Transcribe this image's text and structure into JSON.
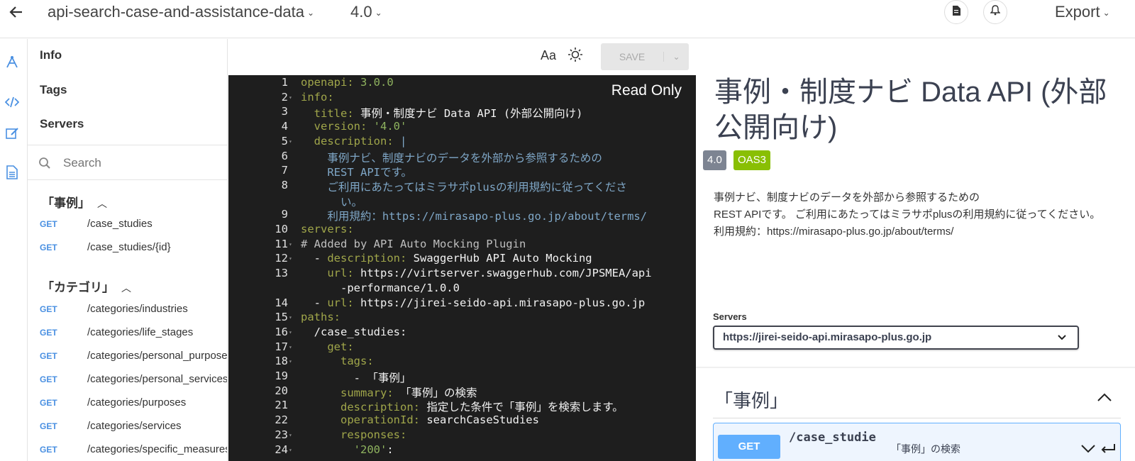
{
  "header": {
    "api_name": "api-search-case-and-assistance-data",
    "version": "4.0",
    "export_label": "Export"
  },
  "nav": {
    "top_items": [
      "Info",
      "Tags",
      "Servers"
    ],
    "search_placeholder": "Search",
    "groups": [
      {
        "title": "「事例」",
        "endpoints": [
          {
            "method": "GET",
            "path": "/case_studies"
          },
          {
            "method": "GET",
            "path": "/case_studies/{id}"
          }
        ]
      },
      {
        "title": "「カテゴリ」",
        "endpoints": [
          {
            "method": "GET",
            "path": "/categories/industries"
          },
          {
            "method": "GET",
            "path": "/categories/life_stages"
          },
          {
            "method": "GET",
            "path": "/categories/personal_purposes"
          },
          {
            "method": "GET",
            "path": "/categories/personal_services"
          },
          {
            "method": "GET",
            "path": "/categories/purposes"
          },
          {
            "method": "GET",
            "path": "/categories/services"
          },
          {
            "method": "GET",
            "path": "/categories/specific_measures"
          }
        ]
      }
    ]
  },
  "editor": {
    "font_label": "Aa",
    "save_label": "SAVE",
    "read_only_label": "Read Only",
    "lines": [
      {
        "n": "1",
        "fold": false,
        "parts": [
          [
            "k",
            "openapi: "
          ],
          [
            "g",
            "3.0.0"
          ]
        ]
      },
      {
        "n": "2",
        "fold": true,
        "parts": [
          [
            "k",
            "info:"
          ]
        ]
      },
      {
        "n": "3",
        "fold": false,
        "parts": [
          [
            "v",
            "  "
          ],
          [
            "k",
            "title: "
          ],
          [
            "v",
            "事例・制度ナビ Data API (外部公開向け)"
          ]
        ]
      },
      {
        "n": "4",
        "fold": false,
        "parts": [
          [
            "v",
            "  "
          ],
          [
            "k",
            "version: "
          ],
          [
            "g",
            "'4.0'"
          ]
        ]
      },
      {
        "n": "5",
        "fold": true,
        "parts": [
          [
            "v",
            "  "
          ],
          [
            "k",
            "description: "
          ],
          [
            "s",
            "|"
          ]
        ]
      },
      {
        "n": "6",
        "fold": false,
        "parts": [
          [
            "s",
            "    事例ナビ、制度ナビのデータを外部から参照するための"
          ]
        ]
      },
      {
        "n": "7",
        "fold": false,
        "parts": [
          [
            "s",
            "    REST APIです。"
          ]
        ]
      },
      {
        "n": "8",
        "fold": false,
        "parts": [
          [
            "s",
            "    ご利用にあたってはミラサポplusの利用規約に従ってくださ"
          ]
        ]
      },
      {
        "n": "",
        "fold": false,
        "parts": [
          [
            "s",
            "      い。"
          ]
        ]
      },
      {
        "n": "9",
        "fold": false,
        "parts": [
          [
            "s",
            "    利用規約：https://mirasapo-plus.go.jp/about/terms/"
          ]
        ]
      },
      {
        "n": "10",
        "fold": false,
        "parts": [
          [
            "k",
            "servers:"
          ]
        ]
      },
      {
        "n": "11",
        "fold": true,
        "parts": [
          [
            "c",
            "# Added by API Auto Mocking Plugin"
          ]
        ]
      },
      {
        "n": "12",
        "fold": true,
        "parts": [
          [
            "v",
            "  - "
          ],
          [
            "k",
            "description: "
          ],
          [
            "v",
            "SwaggerHub API Auto Mocking"
          ]
        ]
      },
      {
        "n": "13",
        "fold": false,
        "parts": [
          [
            "v",
            "    "
          ],
          [
            "k",
            "url: "
          ],
          [
            "v",
            "https://virtserver.swaggerhub.com/JPSMEA/api"
          ]
        ]
      },
      {
        "n": "",
        "fold": false,
        "parts": [
          [
            "v",
            "      -performance/1.0.0"
          ]
        ]
      },
      {
        "n": "14",
        "fold": false,
        "parts": [
          [
            "v",
            "  - "
          ],
          [
            "k",
            "url: "
          ],
          [
            "v",
            "https://jirei-seido-api.mirasapo-plus.go.jp"
          ]
        ]
      },
      {
        "n": "15",
        "fold": true,
        "parts": [
          [
            "k",
            "paths:"
          ]
        ]
      },
      {
        "n": "16",
        "fold": true,
        "parts": [
          [
            "v",
            "  /case_studies:"
          ]
        ]
      },
      {
        "n": "17",
        "fold": true,
        "parts": [
          [
            "v",
            "    "
          ],
          [
            "k",
            "get:"
          ]
        ]
      },
      {
        "n": "18",
        "fold": true,
        "parts": [
          [
            "v",
            "      "
          ],
          [
            "k",
            "tags:"
          ]
        ]
      },
      {
        "n": "19",
        "fold": false,
        "parts": [
          [
            "v",
            "        - 「事例」"
          ]
        ]
      },
      {
        "n": "20",
        "fold": false,
        "parts": [
          [
            "v",
            "      "
          ],
          [
            "k",
            "summary: "
          ],
          [
            "v",
            "「事例」の検索"
          ]
        ]
      },
      {
        "n": "21",
        "fold": false,
        "parts": [
          [
            "v",
            "      "
          ],
          [
            "k",
            "description: "
          ],
          [
            "v",
            "指定した条件で「事例」を検索します。"
          ]
        ]
      },
      {
        "n": "22",
        "fold": false,
        "parts": [
          [
            "v",
            "      "
          ],
          [
            "k",
            "operationId: "
          ],
          [
            "v",
            "searchCaseStudies"
          ]
        ]
      },
      {
        "n": "23",
        "fold": true,
        "parts": [
          [
            "v",
            "      "
          ],
          [
            "k",
            "responses:"
          ]
        ]
      },
      {
        "n": "24",
        "fold": true,
        "parts": [
          [
            "v",
            "        "
          ],
          [
            "g",
            "'200'"
          ],
          [
            "v",
            ":"
          ]
        ]
      }
    ]
  },
  "docs": {
    "title": "事例・制度ナビ Data API (外部公開向け)",
    "version_badge": "4.0",
    "oas_badge": "OAS3",
    "description_lines": [
      "事例ナビ、制度ナビのデータを外部から参照するための",
      "REST APIです。 ご利用にあたってはミラサポplusの利用規約に従ってください。",
      "利用規約：https://mirasapo-plus.go.jp/about/terms/"
    ],
    "servers_label": "Servers",
    "server_selected": "https://jirei-seido-api.mirasapo-plus.go.jp",
    "tag_title": "「事例」",
    "operation": {
      "method": "GET",
      "path": "/case_studie",
      "summary": "「事例」の検索"
    }
  },
  "colors": {
    "get_blue": "#61affe",
    "version_badge": "#7d8492",
    "oas_badge": "#89bf04",
    "editor_bg": "#1e1e1e",
    "yaml_key": "#a0a64a",
    "yaml_string": "#7fa7c7"
  },
  "icons": {
    "back": "arrow-left-icon",
    "file": "file-icon",
    "bell": "bell-icon",
    "rail": [
      "api-design-icon",
      "code-icon",
      "edit-icon",
      "document-icon"
    ],
    "search": "search-icon",
    "theme": "sun-icon"
  }
}
